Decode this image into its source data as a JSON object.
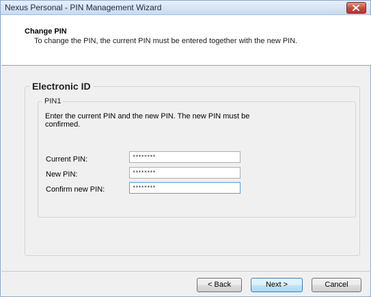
{
  "window": {
    "title": "Nexus Personal - PIN Management Wizard"
  },
  "header": {
    "title": "Change PIN",
    "description": "To change the PIN, the current PIN must be entered together with the new PIN."
  },
  "group": {
    "title": "Electronic ID",
    "pin_group": {
      "title": "PIN1",
      "instructions": "Enter the current PIN and the new PIN. The new PIN must be confirmed.",
      "fields": [
        {
          "label": "Current PIN:",
          "value": "********"
        },
        {
          "label": "New PIN:",
          "value": "********"
        },
        {
          "label": "Confirm new PIN:",
          "value": "********"
        }
      ]
    }
  },
  "buttons": {
    "back": "< Back",
    "next": "Next >",
    "cancel": "Cancel"
  }
}
